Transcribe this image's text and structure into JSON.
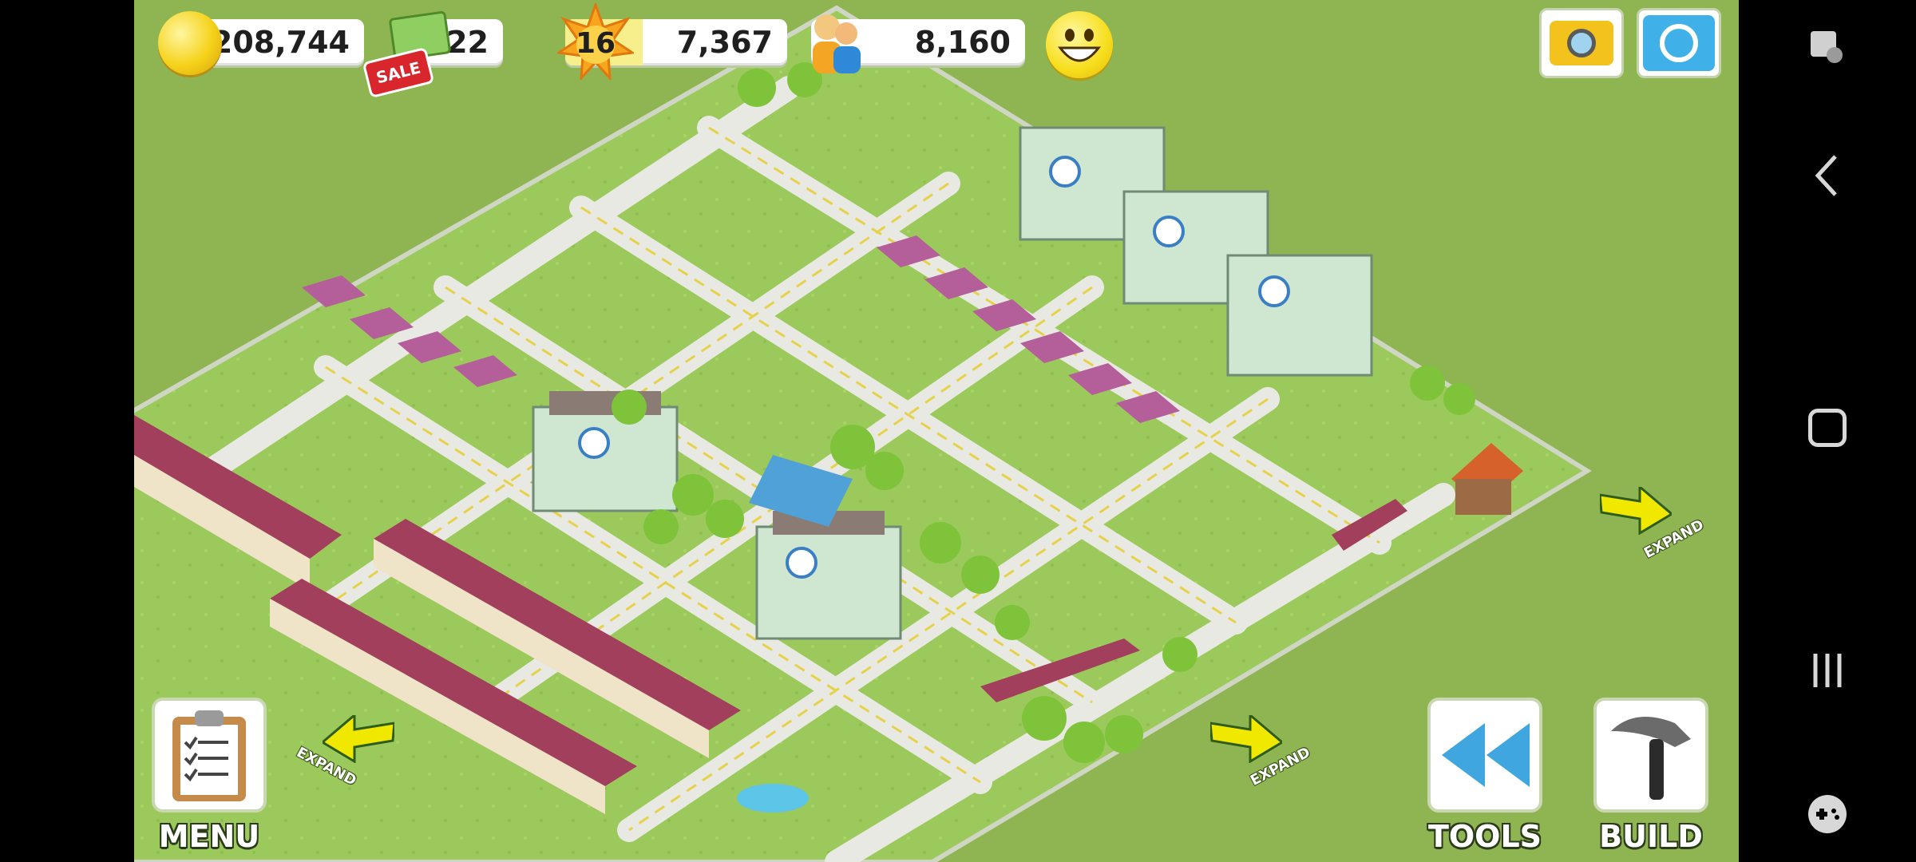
{
  "hud": {
    "coins": "208,744",
    "cash": "22",
    "sale_badge": "SALE",
    "level": "16",
    "xp": "7,367",
    "xp_progress": 0.35,
    "population": "8,160",
    "happiness_icon": "smiley-face-icon"
  },
  "top_buttons": {
    "camera_icon": "camera-icon",
    "social_icon": "social-share-icon"
  },
  "bottom_buttons": {
    "menu_label": "MENU",
    "tools_label": "TOOLS",
    "build_label": "BUILD"
  },
  "expand": {
    "left_label": "EXPAND",
    "bottom_right_label": "EXPAND",
    "right_label": "EXPAND"
  },
  "nav_icons": [
    "screenshot-edit-icon",
    "back-icon",
    "home-icon",
    "recent-apps-icon",
    "game-tools-icon"
  ],
  "colors": {
    "grass": "#8fb552",
    "arrow": "#f1e800",
    "hud_white": "#ffffff",
    "xp_bar": "#f6ef8c"
  }
}
